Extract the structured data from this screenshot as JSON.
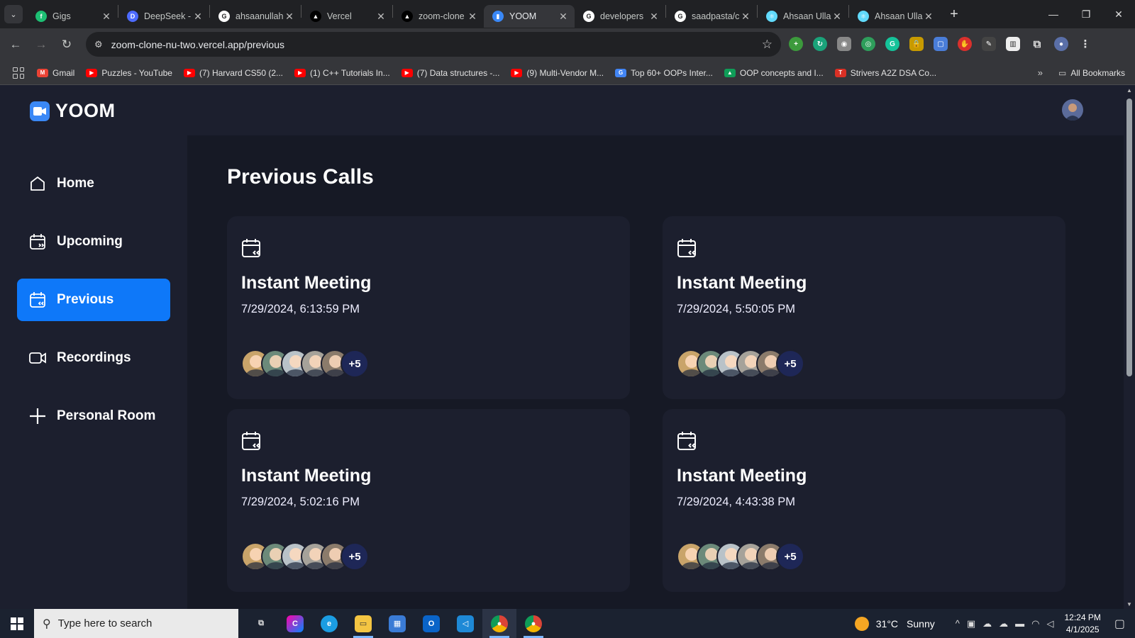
{
  "browser": {
    "tabs": [
      {
        "title": "Gigs",
        "color": "#1dbf73",
        "glyph": "f"
      },
      {
        "title": "DeepSeek -",
        "color": "#4d6bfe",
        "glyph": "D"
      },
      {
        "title": "ahsaanullah",
        "color": "#ffffff",
        "glyph": "G"
      },
      {
        "title": "Vercel",
        "color": "#000000",
        "glyph": "▲"
      },
      {
        "title": "zoom-clone",
        "color": "#000000",
        "glyph": "▲"
      },
      {
        "title": "YOOM",
        "color": "#3a88f6",
        "glyph": "▮",
        "active": true
      },
      {
        "title": "developers",
        "color": "#ffffff",
        "glyph": "G"
      },
      {
        "title": "saadpasta/c",
        "color": "#ffffff",
        "glyph": "G"
      },
      {
        "title": "Ahsaan Ulla",
        "color": "#61dafb",
        "glyph": "⚛"
      },
      {
        "title": "Ahsaan Ulla",
        "color": "#61dafb",
        "glyph": "⚛"
      }
    ],
    "url": "zoom-clone-nu-two.vercel.app/previous",
    "bookmarks": [
      {
        "label": "Gmail",
        "color": "#ea4335",
        "glyph": "M"
      },
      {
        "label": "Puzzles - YouTube",
        "color": "#ff0000",
        "glyph": "▶"
      },
      {
        "label": "(7) Harvard CS50 (2...",
        "color": "#ff0000",
        "glyph": "▶"
      },
      {
        "label": "(1) C++ Tutorials In...",
        "color": "#ff0000",
        "glyph": "▶"
      },
      {
        "label": "(7) Data structures -...",
        "color": "#ff0000",
        "glyph": "▶"
      },
      {
        "label": "(9) Multi-Vendor M...",
        "color": "#ff0000",
        "glyph": "▶"
      },
      {
        "label": "Top 60+ OOPs Inter...",
        "color": "#4285f4",
        "glyph": "G"
      },
      {
        "label": "OOP concepts and I...",
        "color": "#0f9d58",
        "glyph": "▲"
      },
      {
        "label": "Strivers A2Z DSA Co...",
        "color": "#d93025",
        "glyph": "T"
      }
    ],
    "all_bookmarks_label": "All Bookmarks"
  },
  "app": {
    "logo_text": "YOOM",
    "sidebar": {
      "items": [
        {
          "label": "Home",
          "icon": "home-icon"
        },
        {
          "label": "Upcoming",
          "icon": "calendar-upcoming-icon"
        },
        {
          "label": "Previous",
          "icon": "calendar-previous-icon",
          "active": true
        },
        {
          "label": "Recordings",
          "icon": "video-icon"
        },
        {
          "label": "Personal Room",
          "icon": "plus-icon"
        }
      ]
    },
    "page_title": "Previous Calls",
    "calls": [
      {
        "title": "Instant Meeting",
        "date": "7/29/2024, 6:13:59 PM",
        "more": "+5"
      },
      {
        "title": "Instant Meeting",
        "date": "7/29/2024, 5:50:05 PM",
        "more": "+5"
      },
      {
        "title": "Instant Meeting",
        "date": "7/29/2024, 5:02:16 PM",
        "more": "+5"
      },
      {
        "title": "Instant Meeting",
        "date": "7/29/2024, 4:43:38 PM",
        "more": "+5"
      }
    ],
    "avatar_colors": [
      "#c9a46a",
      "#6c8a7a",
      "#b9c2c8",
      "#a6a29a",
      "#8b7b6b"
    ],
    "accent": "#0e78f9"
  },
  "taskbar": {
    "search_placeholder": "Type here to search",
    "weather": {
      "temp": "31°C",
      "condition": "Sunny"
    },
    "time": "12:24 PM",
    "date": "4/1/2025"
  }
}
